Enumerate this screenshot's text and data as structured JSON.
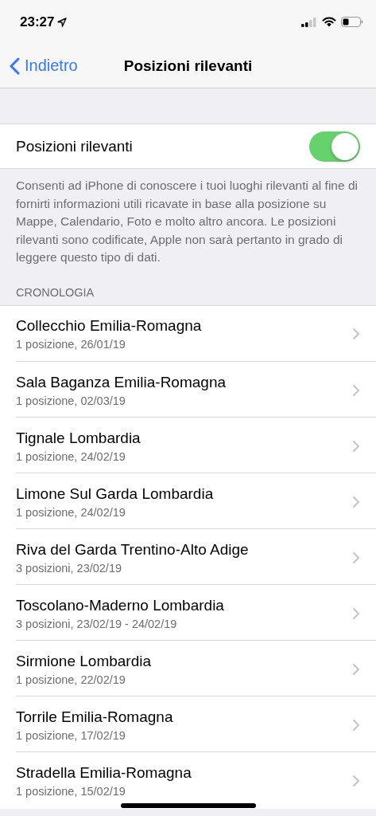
{
  "status_bar": {
    "time": "23:27"
  },
  "nav": {
    "back": "Indietro",
    "title": "Posizioni rilevanti"
  },
  "setting": {
    "label": "Posizioni rilevanti",
    "on": true
  },
  "description": "Consenti ad iPhone di conoscere i tuoi luoghi rilevanti al fine di fornirti informazioni utili ricavate in base alla posizione su Mappe, Calendario, Foto e molto altro ancora. Le posizioni rilevanti sono codificate, Apple non sarà pertanto in grado di leggere questo tipo di dati.",
  "section_header": "CRONOLOGIA",
  "history": [
    {
      "title": "Collecchio Emilia-Romagna",
      "subtitle": "1 posizione, 26/01/19"
    },
    {
      "title": "Sala Baganza Emilia-Romagna",
      "subtitle": "1 posizione, 02/03/19"
    },
    {
      "title": "Tignale Lombardia",
      "subtitle": "1 posizione, 24/02/19"
    },
    {
      "title": "Limone Sul Garda Lombardia",
      "subtitle": "1 posizione, 24/02/19"
    },
    {
      "title": "Riva del Garda Trentino-Alto Adige",
      "subtitle": "3 posizioni, 23/02/19"
    },
    {
      "title": "Toscolano-Maderno Lombardia",
      "subtitle": "3 posizioni, 23/02/19 - 24/02/19"
    },
    {
      "title": "Sirmione Lombardia",
      "subtitle": "1 posizione, 22/02/19"
    },
    {
      "title": "Torrile Emilia-Romagna",
      "subtitle": "1 posizione, 17/02/19"
    },
    {
      "title": "Stradella Emilia-Romagna",
      "subtitle": "1 posizione, 15/02/19"
    }
  ]
}
